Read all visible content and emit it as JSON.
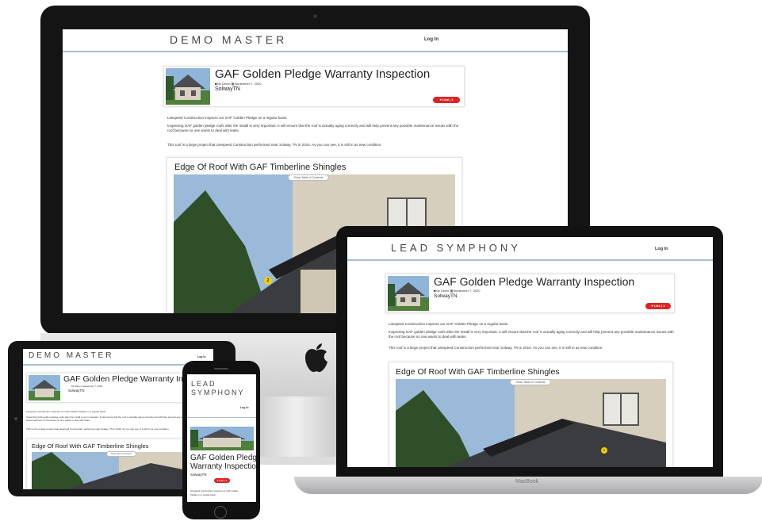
{
  "brand_demo": "DEMO MASTER",
  "brand_lead": "LEAD SYMPHONY",
  "brand_lead_line1": "LEAD",
  "brand_lead_line2": "SYMPHONY",
  "login": "Log In",
  "post": {
    "title": "GAF Golden Pledge Warranty Inspection",
    "title_line1": "GAF Golden Pledge",
    "title_line2": "Warranty Inspection",
    "category": "My Demo",
    "date": "September 7, 2020",
    "author": "SolwayTN",
    "like_label": "Like",
    "like_count": "1"
  },
  "paragraphs": [
    "Litespeed Construction inspects our GAF Golden Pledge on a regular basis.",
    "Inspecting GAF golden pledge roofs after the install is very important. It will ensure that the roof is actually aging correctly and will help prevent any possible maintenance issues with the roof because no one wants to deal with leaks.",
    "This roof is a large project that Litespeed Construction performed near Solway, TN in 2016.  As you can see, it is still in as new condition."
  ],
  "section": {
    "heading": "Edge Of Roof With GAF Timberline Shingles",
    "toc_label": "Show Table of Contents",
    "marker": "2",
    "marker_laptop": "1"
  },
  "phone": {
    "para_line1": "Litespeed Construction inspects our GAF Golden",
    "para_line2": "Pledge on a regular basis."
  },
  "laptop_label": "MacBook",
  "colors": {
    "like_red": "#e02424",
    "nav_line": "#a9bed3",
    "marker_yellow": "#f2d000"
  }
}
